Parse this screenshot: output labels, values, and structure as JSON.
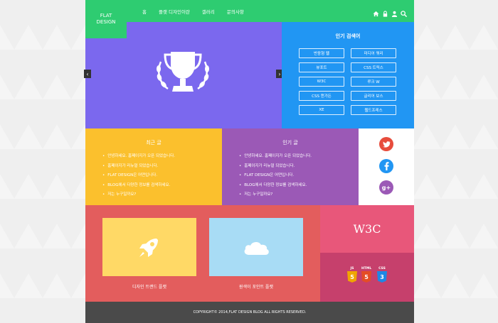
{
  "header": {
    "logo_line1": "FLAT",
    "logo_line2": "DESIGN",
    "nav": [
      "홈",
      "플랫 디자인이란",
      "갤러리",
      "문의사항"
    ],
    "tools": [
      "home-icon",
      "lock-icon",
      "user-icon",
      "search-icon"
    ]
  },
  "popular_search": {
    "title": "인기 검색어",
    "tags": [
      "반응형 웹",
      "미디어 쿼리",
      "뷰포트",
      "CSS 트릭스",
      "W3C",
      "루크 W",
      "CSS 캔가든",
      "글리어 보스",
      "XE",
      "웹드프레스"
    ]
  },
  "recent": {
    "title": "최근 글",
    "items": [
      "안녕하세요. 홈페이지가 오픈 되었습니다.",
      "홈페이지가 리뉴얼 되었습니다.",
      "FLAT DESIGN은 어떤입니다.",
      "BLOG에서 다양한 정보를 검색하세요.",
      "저는 누구일까요?"
    ]
  },
  "popular": {
    "title": "인기 글",
    "items": [
      "안녕하세요. 홈페이지가 오픈 되었습니다.",
      "홈페이지가 리뉴얼 되었습니다.",
      "FLAT DESIGN은 어떤입니다.",
      "BLOG에서 다양한 정보를 검색하세요.",
      "저는 누구일까요?"
    ]
  },
  "social": {
    "gp_label": "g+"
  },
  "cards": {
    "card1_caption": "디자인 트랜드 플랫",
    "card2_caption": "원색이 포인트 플랫"
  },
  "w3c_label": "W3C",
  "tech": {
    "js": "JS",
    "html": "HTML",
    "css": "CSS",
    "js_num": "5",
    "html_num": "5",
    "css_num": "3"
  },
  "footer": {
    "copyright": "COPYRIGHT© 2014,FLAT DESIGN BLOG ALL RIGHTS RESERVED."
  },
  "colors": {
    "green": "#2ecc71",
    "purple": "#7b68ee",
    "blue": "#2196f3",
    "yellow": "#fbc02d",
    "violet": "#9b59b6",
    "red": "#e35d5d",
    "pink": "#e8577a"
  }
}
